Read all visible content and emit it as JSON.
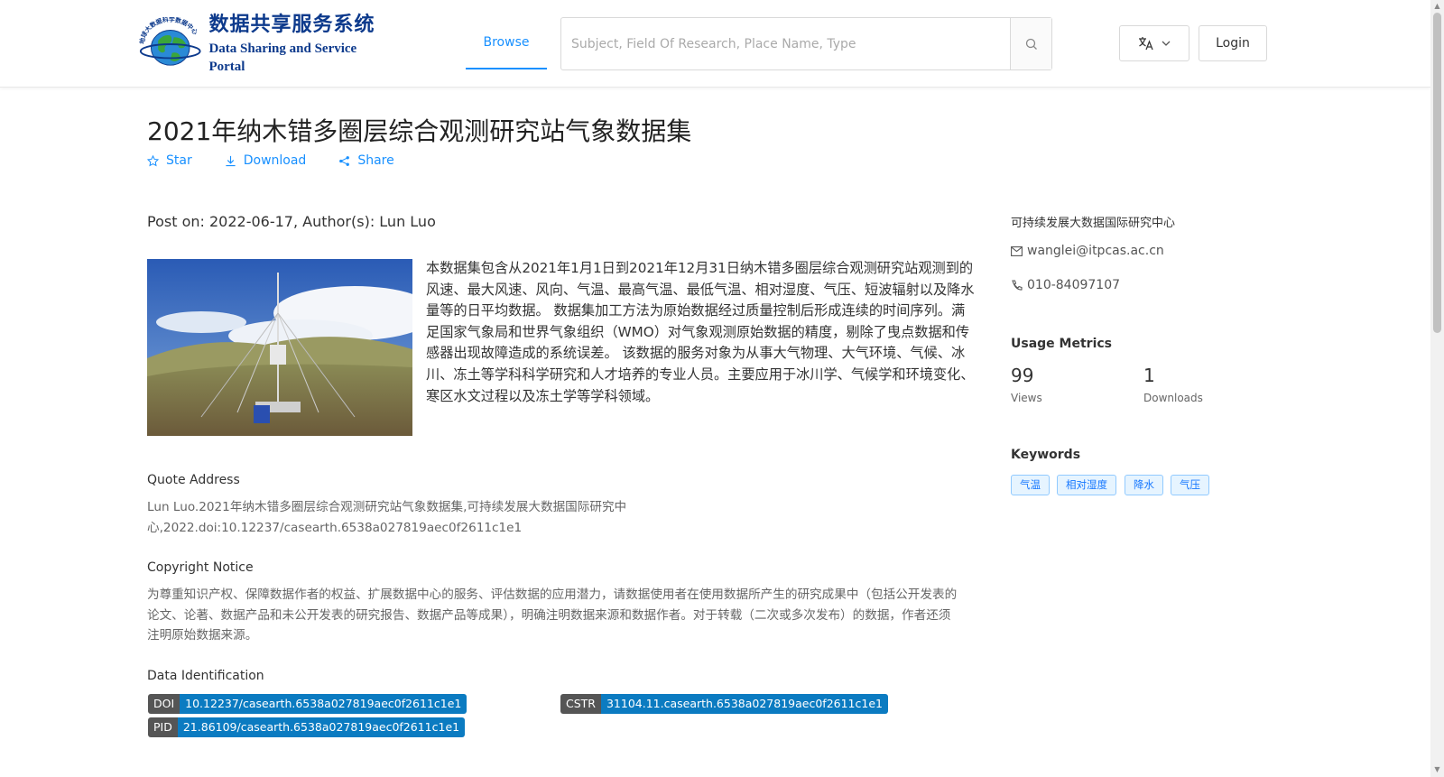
{
  "header": {
    "logo_cn": "数据共享服务系统",
    "logo_en": "Data Sharing and Service Portal",
    "logo_ring_text": "地球大数据科学数据中心",
    "nav_browse": "Browse",
    "search_placeholder": "Subject, Field Of Research, Place Name, Type",
    "login": "Login"
  },
  "dataset": {
    "title": "2021年纳木错多圈层综合观测研究站气象数据集",
    "actions": {
      "star": "Star",
      "download": "Download",
      "share": "Share"
    },
    "post_on": "Post on: 2022-06-17, Author(s): Lun Luo",
    "description": "本数据集包含从2021年1月1日到2021年12月31日纳木错多圈层综合观测研究站观测到的风速、最大风速、风向、气温、最高气温、最低气温、相对湿度、气压、短波辐射以及降水量等的日平均数据。 数据集加工方法为原始数据经过质量控制后形成连续的时间序列。满足国家气象局和世界气象组织（WMO）对气象观测原始数据的精度，剔除了曳点数据和传感器出现故障造成的系统误差。 该数据的服务对象为从事大气物理、大气环境、气候、冰川、冻土等学科科学研究和人才培养的专业人员。主要应用于冰川学、气候学和环境变化、寒区水文过程以及冻土学等学科领域。"
  },
  "quote": {
    "heading": "Quote Address",
    "line1": "Lun Luo.2021年纳木错多圈层综合观测研究站气象数据集,可持续发展大数据国际研究中",
    "line2": "心,2022.doi:10.12237/casearth.6538a027819aec0f2611c1e1"
  },
  "copyright": {
    "heading": "Copyright Notice",
    "line1": "为尊重知识产权、保障数据作者的权益、扩展数据中心的服务、评估数据的应用潜力，请数据使用者在使用数据所产生的研究成果中（包括公开发表的",
    "line2": "论文、论著、数据产品和未公开发表的研究报告、数据产品等成果），明确注明数据来源和数据作者。对于转载（二次或多次发布）的数据，作者还须",
    "line3": "注明原始数据来源。"
  },
  "identification": {
    "heading": "Data Identification",
    "doi_label": "DOI",
    "doi_value": "10.12237/casearth.6538a027819aec0f2611c1e1",
    "cstr_label": "CSTR",
    "cstr_value": "31104.11.casearth.6538a027819aec0f2611c1e1",
    "pid_label": "PID",
    "pid_value": "21.86109/casearth.6538a027819aec0f2611c1e1"
  },
  "sidebar": {
    "org": "可持续发展大数据国际研究中心",
    "email": "wanglei@itpcas.ac.cn",
    "phone": "010-84097107",
    "metrics_heading": "Usage Metrics",
    "views_count": "99",
    "views_label": "Views",
    "downloads_count": "1",
    "downloads_label": "Downloads",
    "keywords_heading": "Keywords",
    "keywords": [
      "气温",
      "相对湿度",
      "降水",
      "气压"
    ]
  },
  "colors": {
    "accent": "#1890ff",
    "badge_value": "#0b7bc1",
    "badge_label": "#555555"
  }
}
